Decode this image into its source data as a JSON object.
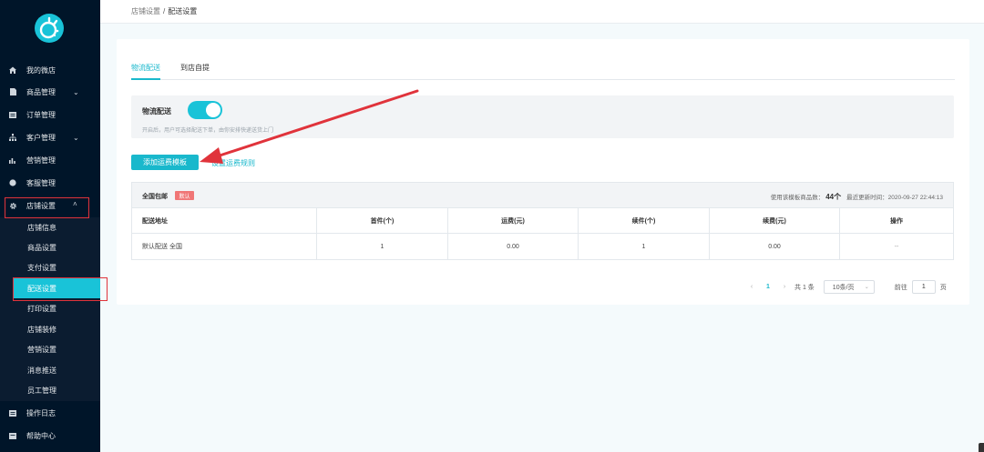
{
  "sidebar": {
    "logo_icon": "app-logo",
    "items": [
      {
        "label": "我的微店",
        "icon": "home-icon"
      },
      {
        "label": "商品管理",
        "icon": "file-icon"
      },
      {
        "label": "订单管理",
        "icon": "list-icon"
      },
      {
        "label": "客户管理",
        "icon": "org-icon"
      },
      {
        "label": "营销管理",
        "icon": "bar-chart-icon"
      },
      {
        "label": "客服管理",
        "icon": "chat-icon"
      },
      {
        "label": "店铺设置",
        "icon": "gear-icon"
      }
    ],
    "sub_items": [
      "店铺信息",
      "商品设置",
      "支付设置",
      "配送设置",
      "打印设置",
      "店铺装修",
      "营销设置",
      "消息推送",
      "员工管理"
    ],
    "bottom_items": [
      {
        "label": "操作日志",
        "icon": "log-icon"
      },
      {
        "label": "帮助中心",
        "icon": "help-icon"
      }
    ],
    "active_sub": "配送设置"
  },
  "breadcrumb": {
    "parent": "店铺设置",
    "separator": "/",
    "current": "配送设置"
  },
  "tabs": [
    "物流配送",
    "到店自提"
  ],
  "logistics": {
    "label": "物流配送",
    "enabled": true,
    "hint": "开启后，用户可选择配送下单，由你安排快递送货上门"
  },
  "actions": {
    "add_template": "添加运费模板",
    "set_rules": "设置运费规则"
  },
  "template": {
    "name": "全国包邮",
    "badge": "默认",
    "usage_label": "使用该模板商品数：",
    "usage_count": "44个",
    "updated_label": "最近更新时间：",
    "updated_time": "2020-09-27 22:44:13",
    "columns": [
      "配送地址",
      "首件(个)",
      "运费(元)",
      "续件(个)",
      "续费(元)",
      "操作"
    ],
    "rows": [
      [
        "默认配送 全国",
        "1",
        "0.00",
        "1",
        "0.00",
        "--"
      ]
    ]
  },
  "pagination": {
    "prev": "‹",
    "page": "1",
    "next": "›",
    "total": "共 1 条",
    "page_size": "10条/页",
    "goto_label": "前往",
    "goto_value": "1",
    "page_suffix": "页"
  },
  "colors": {
    "sidebar_bg": "#001529",
    "accent": "#19b8cc",
    "annotation_red": "#e0333b",
    "badge": "#f07676"
  }
}
